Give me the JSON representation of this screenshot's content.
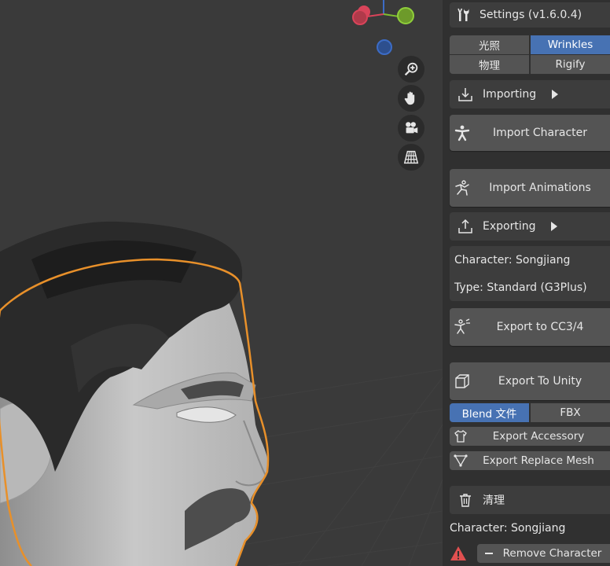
{
  "viewport": {
    "tools": [
      {
        "name": "zoom-icon"
      },
      {
        "name": "pan-hand-icon"
      },
      {
        "name": "camera-icon"
      },
      {
        "name": "perspective-grid-icon"
      }
    ],
    "colors": {
      "background": "#3a3a3a",
      "selection_outline": "#e8902a",
      "gizmo_x": "#d9445a",
      "gizmo_y": "#7fbf2f",
      "gizmo_z": "#3c6cc6"
    }
  },
  "sidebar": {
    "settings": {
      "label": "Settings  (v1.6.0.4)",
      "icon": "wrench-screwdriver-icon"
    },
    "tabs_row1": [
      {
        "label": "光照",
        "active": false
      },
      {
        "label": "Wrinkles",
        "active": true
      }
    ],
    "tabs_row2": [
      {
        "label": "物理",
        "active": false
      },
      {
        "label": "Rigify",
        "active": false
      }
    ],
    "importing": {
      "label": "Importing",
      "icon": "import-icon"
    },
    "import_character": {
      "label": "Import Character",
      "icon": "character-icon"
    },
    "import_animations": {
      "label": "Import Animations",
      "icon": "animation-icon"
    },
    "exporting": {
      "label": "Exporting",
      "icon": "export-icon"
    },
    "info": {
      "character": "Character: Songjiang",
      "type": "Type: Standard (G3Plus)"
    },
    "export_cc": {
      "label": "Export to CC3/4",
      "icon": "character-export-icon"
    },
    "export_unity": {
      "label": "Export To Unity",
      "icon": "cube-icon"
    },
    "format_tabs": [
      {
        "label": "Blend 文件",
        "active": true
      },
      {
        "label": "FBX",
        "active": false
      }
    ],
    "export_accessory": {
      "label": "Export Accessory",
      "icon": "shirt-icon"
    },
    "export_replace_mesh": {
      "label": "Export Replace Mesh",
      "icon": "mesh-icon"
    },
    "cleanup": {
      "label": "清理",
      "icon": "trash-icon"
    },
    "cleanup_character": "Character: Songjiang",
    "remove_character": {
      "label": "Remove Character",
      "icon": "minus-icon"
    },
    "accent": "#4772b3"
  }
}
